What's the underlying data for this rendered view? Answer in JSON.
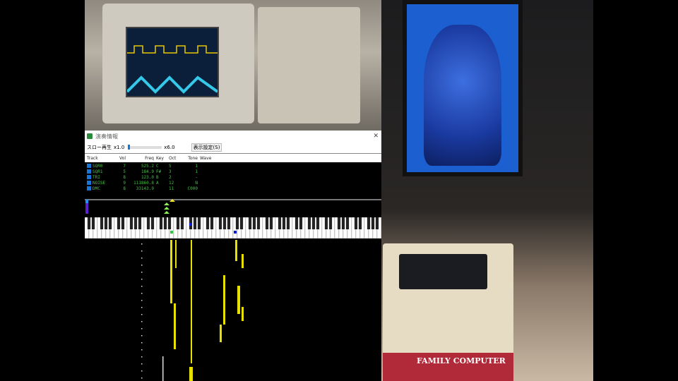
{
  "window": {
    "title": "演奏情報",
    "close_icon": "close-icon"
  },
  "toolbar": {
    "slow_label": "スロー再生",
    "min_label": "x1.0",
    "max_label": "x6.0",
    "slider_value": 1.0,
    "settings_button": "表示設定(S)"
  },
  "table": {
    "headers": [
      "Track",
      "Vol",
      "Freq",
      "Key",
      "Oct",
      "Tone",
      "Wave"
    ],
    "rows": [
      {
        "track": "SQR0",
        "vol": "7",
        "freq": "525.2",
        "key": "C",
        "oct": "5",
        "tone": "1",
        "wave": ""
      },
      {
        "track": "SQR1",
        "vol": "5",
        "freq": "184.9",
        "key": "F#",
        "oct": "3",
        "tone": "1",
        "wave": ""
      },
      {
        "track": "TRI",
        "vol": "8",
        "freq": "123.0",
        "key": "B",
        "oct": "2",
        "tone": "-",
        "wave": ""
      },
      {
        "track": "NOISE",
        "vol": "9",
        "freq": "111860.8",
        "key": "A",
        "oct": "12",
        "tone": "N",
        "wave": ""
      },
      {
        "track": "DMC",
        "vol": "8",
        "freq": "33143.9",
        "key": "",
        "oct": "11",
        "tone": "C000",
        "wave": ""
      }
    ]
  },
  "photo": {
    "famicom_label": "FAMILY COMPUTER"
  },
  "colors": {
    "track_text": "#3fc43f",
    "checkbox": "#1874d6",
    "note_yellow": "#e8e000"
  }
}
